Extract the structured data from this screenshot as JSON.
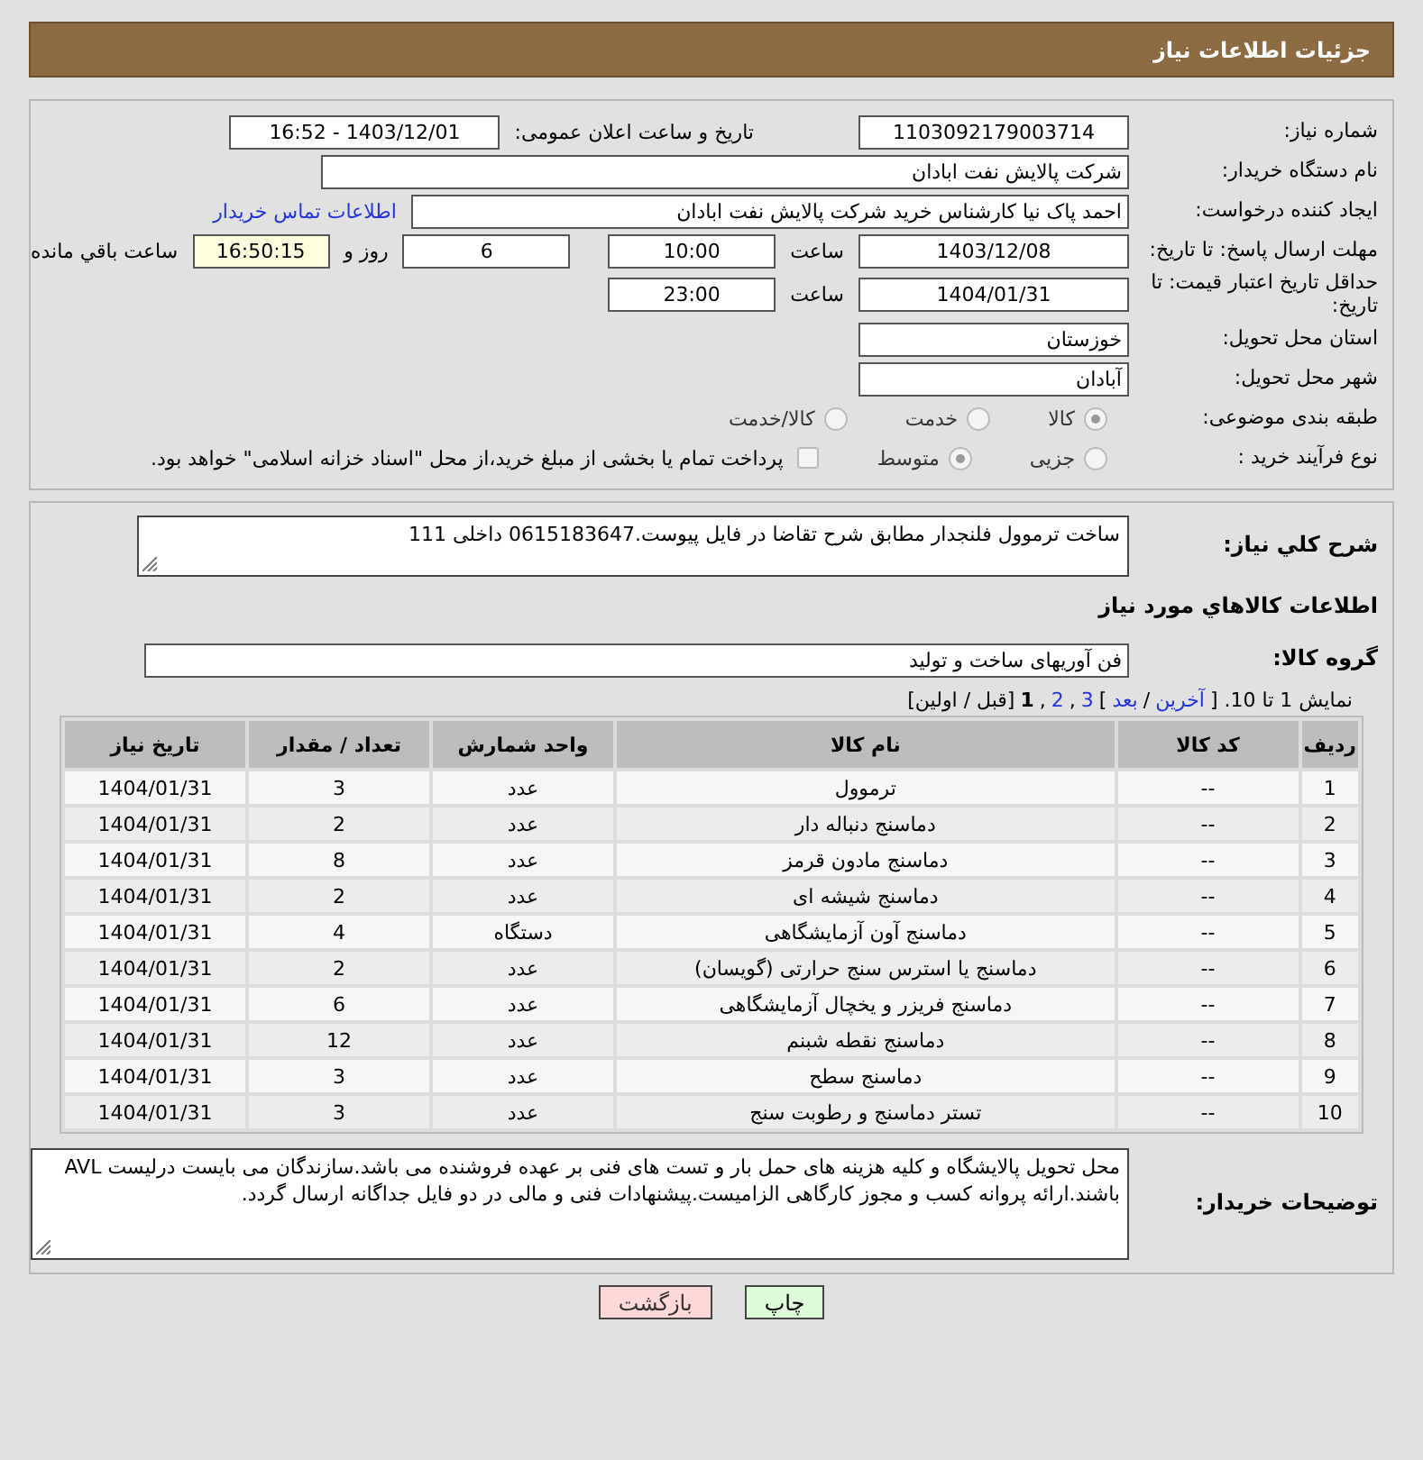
{
  "header": {
    "title": "جزئیات اطلاعات نیاز"
  },
  "info": {
    "need_number": {
      "label": "شماره نیاز:",
      "value": "1103092179003714"
    },
    "announce": {
      "label": "تاریخ و ساعت اعلان عمومی:",
      "value": "1403/12/01 - 16:52"
    },
    "buyer": {
      "label": "نام دستگاه خریدار:",
      "value": "شرکت پالایش نفت ابادان"
    },
    "creator": {
      "label": "ایجاد کننده درخواست:",
      "value": "احمد پاک نیا کارشناس خرید شرکت پالایش نفت ابادان",
      "link": "اطلاعات تماس خریدار"
    },
    "deadline": {
      "label": "مهلت ارسال پاسخ: تا تاریخ:",
      "date": "1403/12/08",
      "time_label": "ساعت",
      "time": "10:00",
      "days": "6",
      "days_label": "روز و",
      "remaining": "16:50:15",
      "remaining_label": "ساعت باقي مانده"
    },
    "validity": {
      "label": "حداقل تاریخ اعتبار قیمت: تا تاریخ:",
      "date": "1404/01/31",
      "time_label": "ساعت",
      "time": "23:00"
    },
    "province": {
      "label": "استان محل تحویل:",
      "value": "خوزستان"
    },
    "city": {
      "label": "شهر محل تحویل:",
      "value": "آبادان"
    },
    "category": {
      "label": "طبقه بندی موضوعی:",
      "options": [
        {
          "label": "کالا",
          "selected": true
        },
        {
          "label": "خدمت",
          "selected": false
        },
        {
          "label": "کالا/خدمت",
          "selected": false
        }
      ]
    },
    "process": {
      "label": "نوع فرآیند خرید :",
      "options": [
        {
          "label": "جزیی",
          "selected": false
        },
        {
          "label": "متوسط",
          "selected": true
        }
      ],
      "payment": {
        "label": "پرداخت تمام یا بخشی از مبلغ خرید،از محل \"اسناد خزانه اسلامی\" خواهد بود.",
        "checked": false
      }
    }
  },
  "details": {
    "description": {
      "label": "شرح كلي نياز:",
      "value": "ساخت ترموول فلنجدار مطابق شرح تقاضا در فایل پیوست.0615183647 داخلی 111"
    },
    "section_title": "اطلاعات کالاهاي مورد نياز",
    "group": {
      "label": "گروه کالا:",
      "value": "فن آوریهای ساخت و تولید"
    },
    "pager": [
      {
        "text": "نمایش 1 تا 10. [",
        "kind": "text"
      },
      {
        "text": "آخرین",
        "kind": "link"
      },
      {
        "text": "/",
        "kind": "text"
      },
      {
        "text": "بعد",
        "kind": "link"
      },
      {
        "text": "]",
        "kind": "text"
      },
      {
        "text": "3",
        "kind": "link"
      },
      {
        "text": ",",
        "kind": "text"
      },
      {
        "text": "2",
        "kind": "link"
      },
      {
        "text": ",",
        "kind": "text"
      },
      {
        "text": "1",
        "kind": "current"
      },
      {
        "text": "[قبل / اولین]",
        "kind": "text"
      }
    ],
    "table": {
      "columns": [
        "ردیف",
        "کد کالا",
        "نام کالا",
        "واحد شمارش",
        "تعداد / مقدار",
        "تاریخ نیاز"
      ],
      "rows": [
        [
          "1",
          "--",
          "ترموول",
          "عدد",
          "3",
          "1404/01/31"
        ],
        [
          "2",
          "--",
          "دماسنج دنباله دار",
          "عدد",
          "2",
          "1404/01/31"
        ],
        [
          "3",
          "--",
          "دماسنج مادون قرمز",
          "عدد",
          "8",
          "1404/01/31"
        ],
        [
          "4",
          "--",
          "دماسنج شیشه ای",
          "عدد",
          "2",
          "1404/01/31"
        ],
        [
          "5",
          "--",
          "دماسنج آون آزمایشگاهی",
          "دستگاه",
          "4",
          "1404/01/31"
        ],
        [
          "6",
          "--",
          "دماسنج یا استرس سنج حرارتی (گویسان)",
          "عدد",
          "2",
          "1404/01/31"
        ],
        [
          "7",
          "--",
          "دماسنج فریزر و یخچال آزمایشگاهی",
          "عدد",
          "6",
          "1404/01/31"
        ],
        [
          "8",
          "--",
          "دماسنج نقطه شبنم",
          "عدد",
          "12",
          "1404/01/31"
        ],
        [
          "9",
          "--",
          "دماسنج سطح",
          "عدد",
          "3",
          "1404/01/31"
        ],
        [
          "10",
          "--",
          "تستر دماسنج و رطوبت سنج",
          "عدد",
          "3",
          "1404/01/31"
        ]
      ]
    },
    "notes": {
      "label": "توضیحات خریدار:",
      "value": "محل تحویل پالایشگاه و کلیه هزینه های حمل بار و تست های فنی بر عهده فروشنده می باشد.سازندگان می بایست درلیست AVL باشند.ارائه پروانه کسب و مجوز کارگاهی الزامیست.پیشنهادات فنی و مالی در دو فایل جداگانه ارسال گردد."
    }
  },
  "buttons": [
    {
      "label": "چاپ",
      "kind": "print"
    },
    {
      "label": "بازگشت",
      "kind": "back"
    }
  ]
}
